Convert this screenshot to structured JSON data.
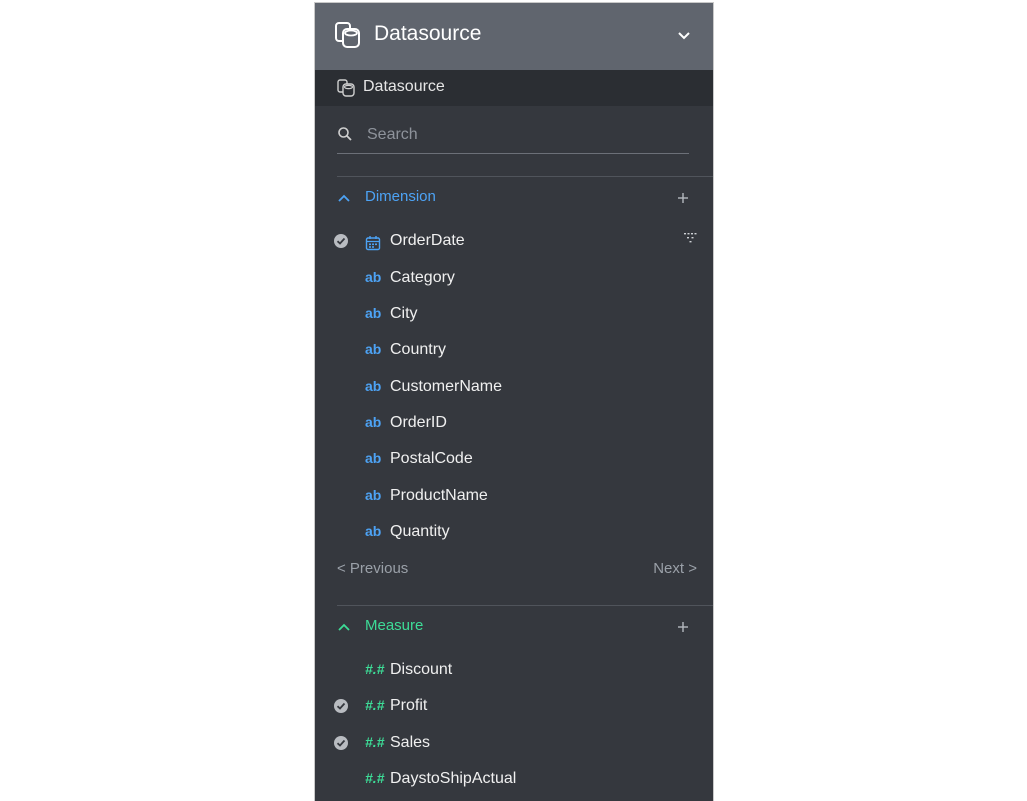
{
  "header": {
    "title": "Datasource"
  },
  "subbar": {
    "title": "Datasource"
  },
  "search": {
    "placeholder": "Search"
  },
  "dimension": {
    "title": "Dimension",
    "fields": [
      {
        "name": "OrderDate",
        "icon": "calendar-icon",
        "selected": true
      },
      {
        "name": "Category",
        "icon": "ab",
        "selected": false
      },
      {
        "name": "City",
        "icon": "ab",
        "selected": false
      },
      {
        "name": "Country",
        "icon": "ab",
        "selected": false
      },
      {
        "name": "CustomerName",
        "icon": "ab",
        "selected": false
      },
      {
        "name": "OrderID",
        "icon": "ab",
        "selected": false
      },
      {
        "name": "PostalCode",
        "icon": "ab",
        "selected": false
      },
      {
        "name": "ProductName",
        "icon": "ab",
        "selected": false
      },
      {
        "name": "Quantity",
        "icon": "ab",
        "selected": false
      }
    ]
  },
  "pager": {
    "previous": "< Previous",
    "next": "Next >"
  },
  "measure": {
    "title": "Measure",
    "fields": [
      {
        "name": "Discount",
        "icon": "#.#",
        "selected": false
      },
      {
        "name": "Profit",
        "icon": "#.#",
        "selected": true
      },
      {
        "name": "Sales",
        "icon": "#.#",
        "selected": true
      },
      {
        "name": "DaystoShipActual",
        "icon": "#.#",
        "selected": false
      }
    ]
  },
  "colors": {
    "header_bg": "#60656e",
    "panel_bg": "#35383e",
    "dimension_accent": "#4da3f5",
    "measure_accent": "#3ddc97"
  }
}
